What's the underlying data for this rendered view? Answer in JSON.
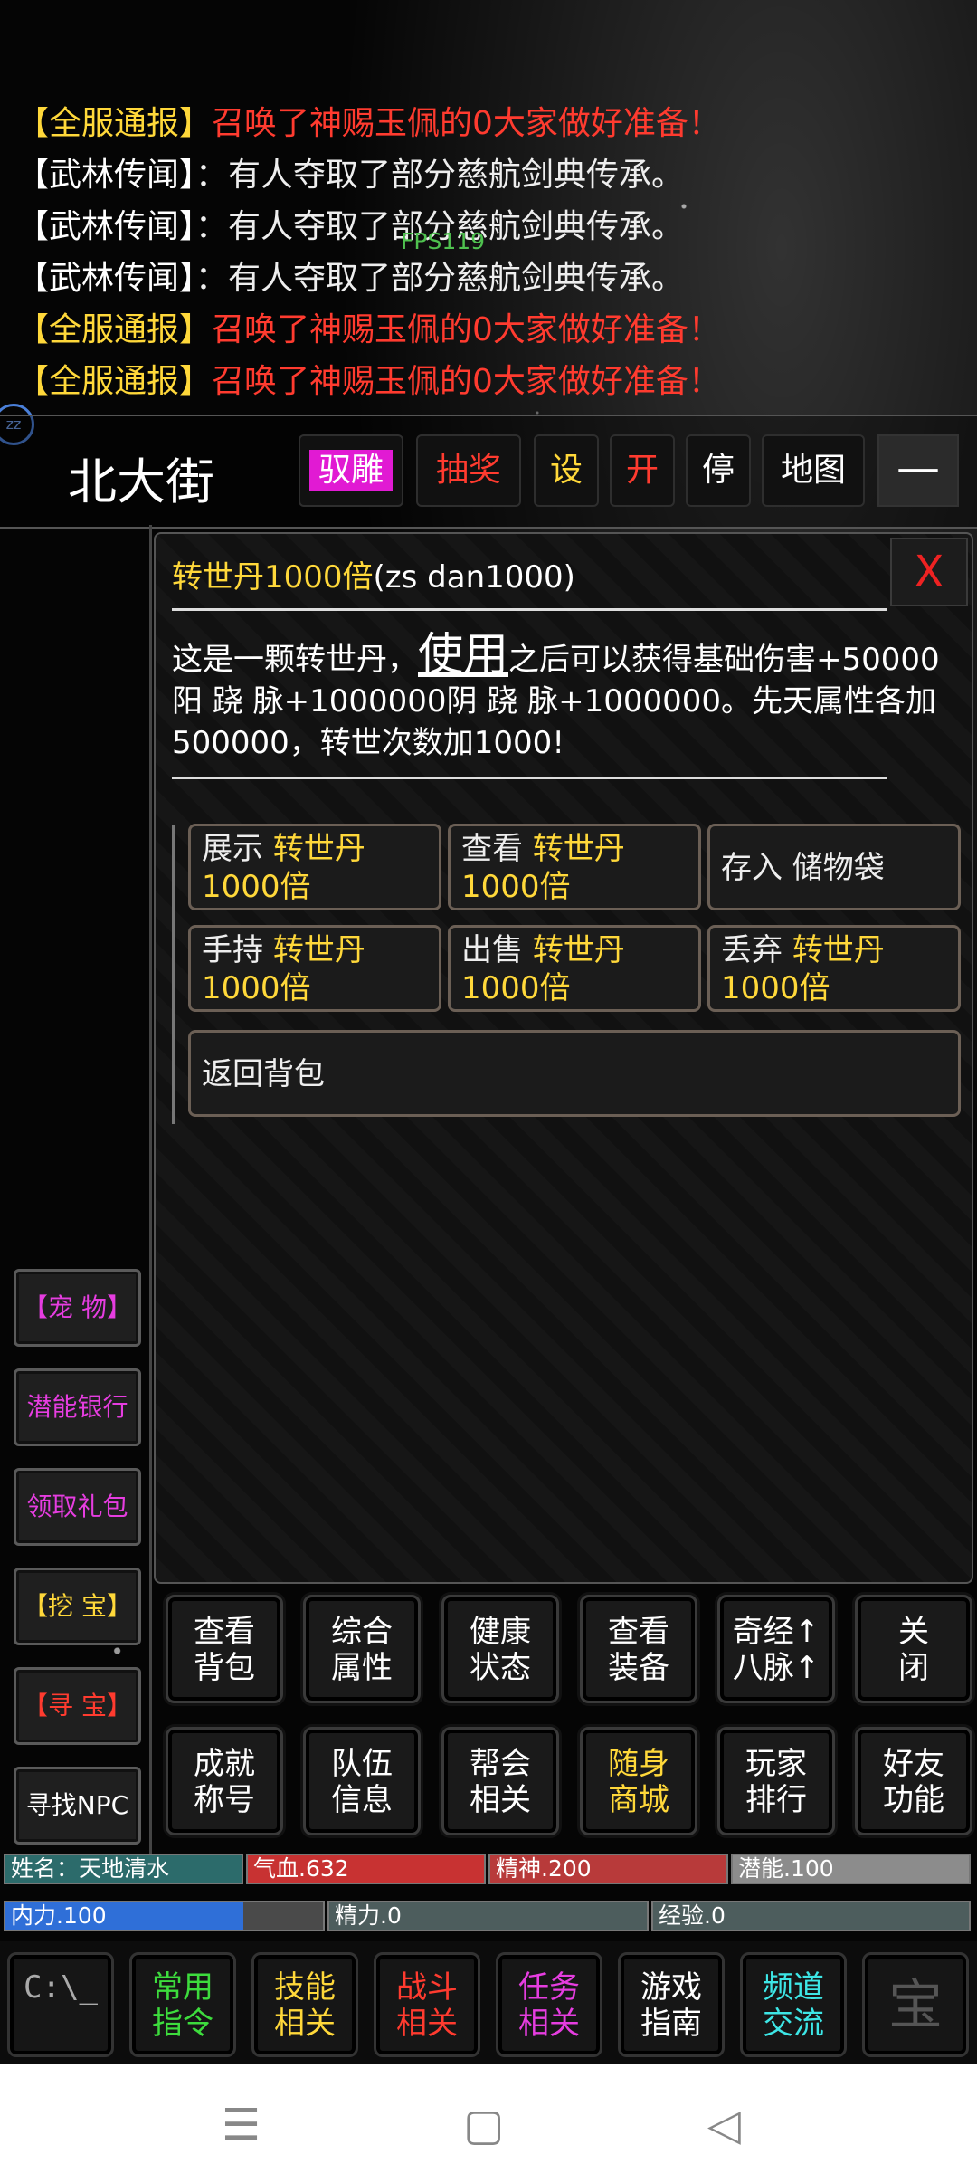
{
  "broadcast": [
    {
      "tag": "【全服通报】",
      "text": "召唤了神赐玉佩的0大家做好准备！",
      "type": "server"
    },
    {
      "tag": "【武林传闻】",
      "text": "：有人夺取了部分慈航剑典传承。",
      "type": "rumor"
    },
    {
      "tag": "【武林传闻】",
      "text": "：有人夺取了部分慈航剑典传承。",
      "type": "rumor"
    },
    {
      "tag": "【武林传闻】",
      "text": "：有人夺取了部分慈航剑典传承。",
      "type": "rumor"
    },
    {
      "tag": "【全服通报】",
      "text": "召唤了神赐玉佩的0大家做好准备！",
      "type": "server"
    },
    {
      "tag": "【全服通报】",
      "text": "召唤了神赐玉佩的0大家做好准备！",
      "type": "server"
    }
  ],
  "fps": "FPS119",
  "status_icon": "zz",
  "header": {
    "location": "北大街",
    "buttons": [
      {
        "label": "驭雕",
        "color": "#ffffff",
        "highlight": true
      },
      {
        "label": "抽奖",
        "color": "#ff3b2f"
      },
      {
        "label": "设",
        "color": "#ffd83a"
      },
      {
        "label": "开",
        "color": "#ff3b2f"
      },
      {
        "label": "停",
        "color": "#ffffff"
      },
      {
        "label": "地图",
        "color": "#ffffff"
      }
    ],
    "minimize": "—"
  },
  "side_buttons": [
    {
      "label": "【宠 物】",
      "color": "#e63de0"
    },
    {
      "label": "潜能银行",
      "color": "#e63de0"
    },
    {
      "label": "领取礼包",
      "color": "#e63de0"
    },
    {
      "label": "【挖 宝】",
      "color": "#ffd83a"
    },
    {
      "label": "【寻 宝】",
      "color": "#ff3b2f"
    },
    {
      "label": "寻找NPC",
      "color": "#ffffff"
    }
  ],
  "item": {
    "name": "转世丹1000倍",
    "code": "(zs dan1000)",
    "close": "X",
    "desc_pre": "这是一颗转世丹，",
    "desc_use": "使用",
    "desc_post": "之后可以获得基础伤害+50000阳 跷 脉+1000000阴 跷 脉+1000000。先天属性各加500000，转世次数加1000!",
    "actions": [
      {
        "verb": "展示",
        "obj": "转世丹",
        "obj2": "1000倍"
      },
      {
        "verb": "查看",
        "obj": "转世丹",
        "obj2": "1000倍"
      },
      {
        "verb": "存入 储物袋",
        "obj": "",
        "obj2": ""
      },
      {
        "verb": "手持",
        "obj": "转世丹",
        "obj2": "1000倍"
      },
      {
        "verb": "出售",
        "obj": "转世丹",
        "obj2": "1000倍"
      },
      {
        "verb": "丢弃",
        "obj": "转世丹",
        "obj2": "1000倍"
      }
    ],
    "back": "返回背包"
  },
  "commands": [
    {
      "l1": "查看",
      "l2": "背包"
    },
    {
      "l1": "综合",
      "l2": "属性"
    },
    {
      "l1": "健康",
      "l2": "状态"
    },
    {
      "l1": "查看",
      "l2": "装备"
    },
    {
      "l1": "奇经↑",
      "l2": "八脉↑"
    },
    {
      "l1": "关",
      "l2": "闭"
    },
    {
      "l1": "成就",
      "l2": "称号"
    },
    {
      "l1": "队伍",
      "l2": "信息"
    },
    {
      "l1": "帮会",
      "l2": "相关"
    },
    {
      "l1": "随身",
      "l2": "商城",
      "yellow": true
    },
    {
      "l1": "玩家",
      "l2": "排行"
    },
    {
      "l1": "好友",
      "l2": "功能"
    }
  ],
  "stats": {
    "name": "姓名：天地清水",
    "hp": "气血.632",
    "spirit": "精神.200",
    "potential": "潜能.100",
    "inner": "内力.100",
    "energy": "精力.0",
    "exp": "经验.0",
    "inner_fill": 0.75
  },
  "dock": [
    {
      "l1": "C:\\_",
      "l2": "",
      "color": "#aaaaaa"
    },
    {
      "l1": "常用",
      "l2": "指令",
      "color": "#3ddc3d"
    },
    {
      "l1": "技能",
      "l2": "相关",
      "color": "#ffd83a"
    },
    {
      "l1": "战斗",
      "l2": "相关",
      "color": "#ff3b2f"
    },
    {
      "l1": "任务",
      "l2": "相关",
      "color": "#e63de0"
    },
    {
      "l1": "游戏",
      "l2": "指南",
      "color": "#ffffff"
    },
    {
      "l1": "频道",
      "l2": "交流",
      "color": "#3de6e6"
    },
    {
      "l1": "宝",
      "l2": "",
      "color": "#555555"
    }
  ],
  "nav": {
    "menu": "☰",
    "home": "▢",
    "back": "◁"
  }
}
